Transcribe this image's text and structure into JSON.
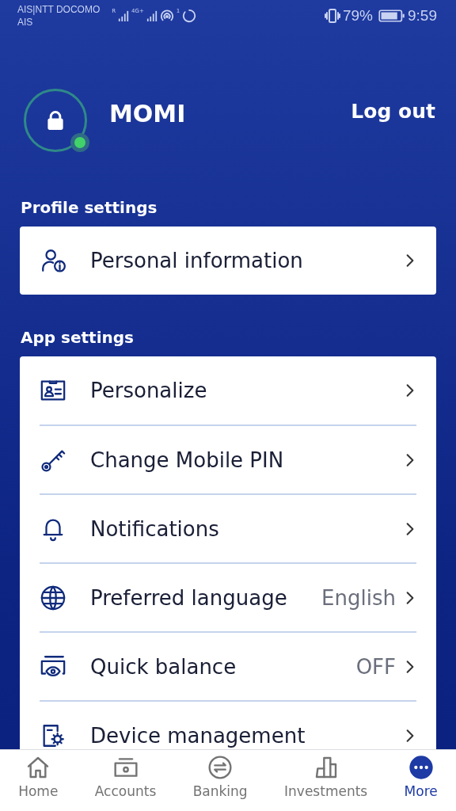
{
  "status_bar": {
    "carrier_1": "AIS|NTT DOCOMO",
    "carrier_2": "AIS",
    "signal_1_tag": "R",
    "signal_2_tag": "4G+",
    "hotspot_count": "1",
    "battery": "79%",
    "time": "9:59"
  },
  "header": {
    "name": "MOMI",
    "logout": "Log out",
    "online": true
  },
  "sections": [
    {
      "title": "Profile settings",
      "items": [
        {
          "label": "Personal information"
        }
      ]
    },
    {
      "title": "App settings",
      "items": [
        {
          "label": "Personalize"
        },
        {
          "label": "Change Mobile PIN"
        },
        {
          "label": "Notifications"
        },
        {
          "label": "Preferred language",
          "value": "English"
        },
        {
          "label": "Quick balance",
          "value": "OFF"
        },
        {
          "label": "Device management"
        }
      ]
    }
  ],
  "nav": [
    {
      "label": "Home",
      "selected": false
    },
    {
      "label": "Accounts",
      "selected": false
    },
    {
      "label": "Banking",
      "selected": false
    },
    {
      "label": "Investments",
      "selected": false
    },
    {
      "label": "More",
      "selected": true
    }
  ]
}
